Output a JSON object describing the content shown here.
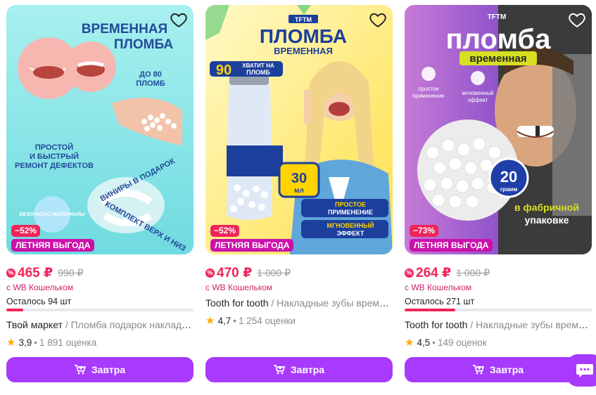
{
  "products": [
    {
      "image": {
        "headline": "ВРЕМЕННАЯ",
        "headline2": "ПЛОМБА",
        "count_line1": "ДО 80",
        "count_line2": "ПЛОМБ",
        "feature_line1": "ПРОСТОЙ",
        "feature_line2": "И БЫСТРЫЙ",
        "feature_line3": "РЕМОНТ ДЕФЕКТОВ",
        "gift_text": "ВИНИРЫ В ПОДАРОК",
        "set_text": "КОМПЛЕКТ ВЕРХ И НИЗ",
        "safe_text": "БЕЗОПАСНО МАТЕРИАЛЫ"
      },
      "discount": "−52%",
      "promo": "ЛЕТНЯЯ ВЫГОДА",
      "price": "465 ₽",
      "old_price": "990 ₽",
      "wallet": "с WB Кошельком",
      "stock_text": "Осталось 94 шт",
      "stock_fraction": 0.09,
      "brand": "Твой маркет",
      "category": " / Пломба подарок накладные",
      "rating": "3,9",
      "reviews": "1 891 оценка",
      "button": "Завтра"
    },
    {
      "image": {
        "logo": "TFTM",
        "headline": "ПЛОМБА",
        "subheadline": "ВРЕМЕННАЯ",
        "count_big": "90",
        "count_line1": "ХВАТИТ НА",
        "count_line2": "ПЛОМБ",
        "volume": "30",
        "volume_unit": "мл",
        "feature1_line1": "ПРОСТОЕ",
        "feature1_line2": "ПРИМЕНЕНИЕ",
        "feature2_line1": "МГНОВЕННЫЙ",
        "feature2_line2": "ЭФФЕКТ"
      },
      "discount": "−52%",
      "promo": "ЛЕТНЯЯ ВЫГОДА",
      "price": "470 ₽",
      "old_price": "1 000 ₽",
      "wallet": "с WB Кошельком",
      "brand": "Tooth for tooth",
      "category": " / Накладные зубы временные",
      "rating": "4,7",
      "reviews": "1 254 оценки",
      "button": "Завтра"
    },
    {
      "image": {
        "logo": "TFTM",
        "headline": "пломба",
        "subheadline": "временная",
        "feature1_line1": "простое",
        "feature1_line2": "применение",
        "feature2_line1": "мгновенный",
        "feature2_line2": "эффект",
        "weight": "20",
        "weight_unit": "грамм",
        "pack_line1": "в фабричной",
        "pack_line2": "упаковке"
      },
      "discount": "−73%",
      "promo": "ЛЕТНЯЯ ВЫГОДА",
      "price": "264 ₽",
      "old_price": "1 000 ₽",
      "wallet": "с WB Кошельком",
      "stock_text": "Осталось 271 шт",
      "stock_fraction": 0.27,
      "brand": "Tooth for tooth",
      "category": " / Накладные зубы временные",
      "rating": "4,5",
      "reviews": "149 оценок",
      "button": "Завтра"
    }
  ],
  "icons": {
    "favorite": "heart-icon",
    "cart": "cart-icon",
    "rating": "star-icon",
    "chat": "chat-icon",
    "discount": "percent-icon"
  },
  "colors": {
    "accent": "#a73afd",
    "price": "#f0245a",
    "promo": "#cb11ab",
    "wallet": "#d1216e",
    "star": "#ffa800"
  }
}
